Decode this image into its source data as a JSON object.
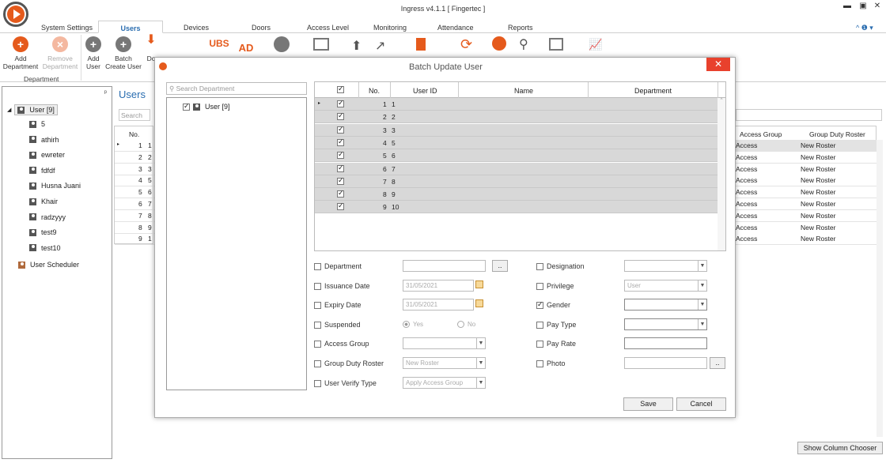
{
  "window": {
    "title": "Ingress v4.1.1 [ Fingertec ]",
    "minimize": "▬",
    "maximize": "▣",
    "close": "✕",
    "help_icons": "^ ❶ ▾"
  },
  "tabs": [
    "System Settings",
    "Users",
    "Devices",
    "Doors",
    "Access Level",
    "Monitoring",
    "Attendance",
    "Reports"
  ],
  "ribbon": {
    "add_department": "Add Department",
    "remove_department": "Remove Department",
    "group_department": "Department",
    "add_user": "Add User",
    "batch_create_user": "Batch Create User",
    "download": "Do",
    "ubs": "UBS",
    "ad": "AD"
  },
  "left_tree": {
    "pin": "ᵖ",
    "root": "User [9]",
    "children": [
      "5",
      "athirh",
      "ewreter",
      "fdfdf",
      "Husna Juani",
      "Khair",
      "radzyyy",
      "test9",
      "test10"
    ],
    "scheduler": "User Scheduler"
  },
  "main": {
    "title": "Users",
    "search_placeholder": "Search",
    "no_header": "No.",
    "access_group_header": "Access Group",
    "group_duty_roster_header": "Group Duty Roster",
    "rows": [
      {
        "no": "1",
        "uid": "1",
        "access": "Access",
        "roster": "New Roster"
      },
      {
        "no": "2",
        "uid": "2",
        "access": "Access",
        "roster": "New Roster"
      },
      {
        "no": "3",
        "uid": "3",
        "access": "Access",
        "roster": "New Roster"
      },
      {
        "no": "4",
        "uid": "5",
        "access": "Access",
        "roster": "New Roster"
      },
      {
        "no": "5",
        "uid": "6",
        "access": "Access",
        "roster": "New Roster"
      },
      {
        "no": "6",
        "uid": "7",
        "access": "Access",
        "roster": "New Roster"
      },
      {
        "no": "7",
        "uid": "8",
        "access": "Access",
        "roster": "New Roster"
      },
      {
        "no": "8",
        "uid": "9",
        "access": "Access",
        "roster": "New Roster"
      },
      {
        "no": "9",
        "uid": "1",
        "access": "Access",
        "roster": "New Roster"
      }
    ],
    "show_column_chooser": "Show Column Chooser"
  },
  "modal": {
    "title": "Batch Update User",
    "close": "✕",
    "search_department_placeholder": "Search Department",
    "dept_tree_root": "User [9]",
    "grid_headers": {
      "no": "No.",
      "user_id": "User ID",
      "name": "Name",
      "department": "Department"
    },
    "grid_rows": [
      {
        "no": "1",
        "user_id": "1"
      },
      {
        "no": "2",
        "user_id": "2"
      },
      {
        "no": "3",
        "user_id": "3"
      },
      {
        "no": "4",
        "user_id": "5"
      },
      {
        "no": "5",
        "user_id": "6"
      },
      {
        "no": "6",
        "user_id": "7"
      },
      {
        "no": "7",
        "user_id": "8"
      },
      {
        "no": "8",
        "user_id": "9"
      },
      {
        "no": "9",
        "user_id": "10"
      }
    ],
    "fields": {
      "department": "Department",
      "issuance_date": "Issuance Date",
      "issuance_value": "31/05/2021",
      "expiry_date": "Expiry Date",
      "expiry_value": "31/05/2021",
      "suspended": "Suspended",
      "yes": "Yes",
      "no": "No",
      "access_group": "Access Group",
      "group_duty_roster": "Group Duty Roster",
      "group_duty_roster_value": "New Roster",
      "user_verify_type": "User Verify Type",
      "user_verify_value": "Apply Access Group",
      "designation": "Designation",
      "privilege": "Privilege",
      "privilege_value": "User",
      "gender": "Gender",
      "pay_type": "Pay Type",
      "pay_rate": "Pay Rate",
      "photo": "Photo",
      "browse": ".."
    },
    "save": "Save",
    "cancel": "Cancel"
  },
  "colors": {
    "accent": "#e55a1c",
    "tab_active": "#2a6db0",
    "close_red": "#e8412d",
    "grid_row": "#d8d8d8"
  }
}
